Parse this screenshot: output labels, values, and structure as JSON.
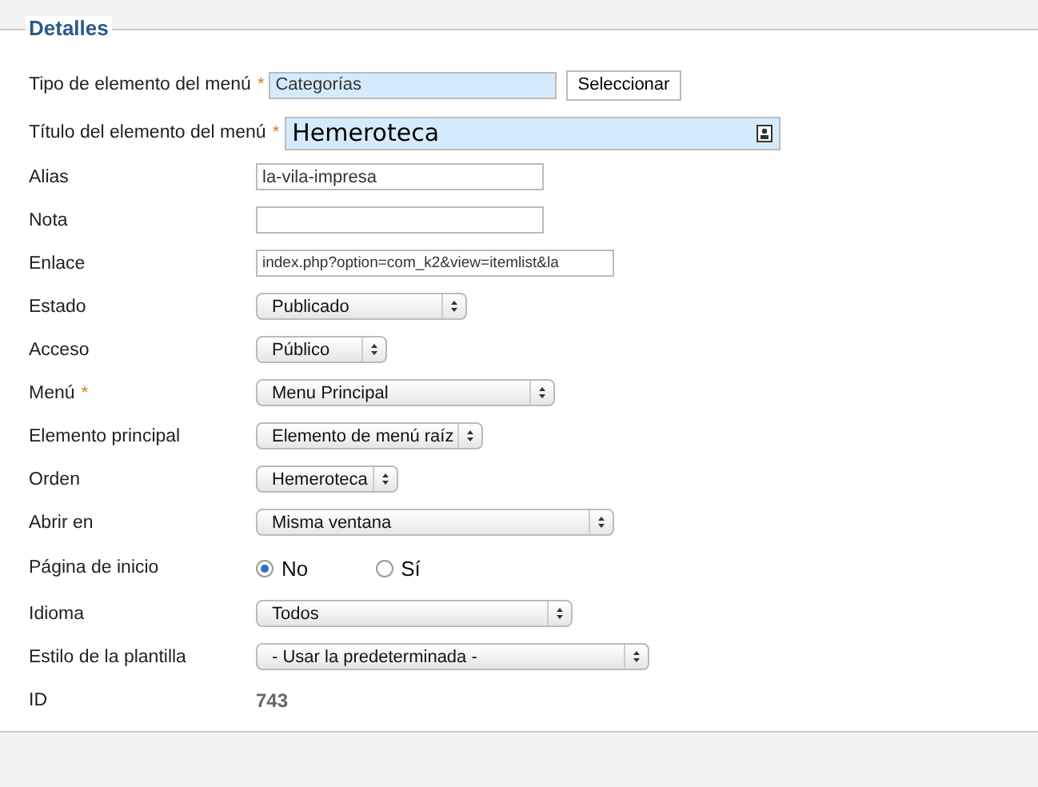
{
  "section": {
    "legend": "Detalles"
  },
  "fields": [
    {
      "kind": "picker",
      "label": "Tipo de elemento del menú",
      "required": "*",
      "value": "Categorías",
      "button": "Seleccionar"
    },
    {
      "kind": "title",
      "label": "Título del elemento del menú",
      "required": "*",
      "value": "Hemeroteca"
    },
    {
      "kind": "text",
      "label": "Alias",
      "value": "la-vila-impresa"
    },
    {
      "kind": "text",
      "label": "Nota"
    },
    {
      "kind": "link",
      "label": "Enlace",
      "value": "index.php?option=com_k2&view=itemlist&la"
    },
    {
      "kind": "select",
      "label": "Estado",
      "value": "Publicado"
    },
    {
      "kind": "select",
      "label": "Acceso",
      "value": "Público"
    },
    {
      "kind": "select",
      "label": "Menú",
      "required": "*",
      "value": "Menu Principal"
    },
    {
      "kind": "select",
      "label": "Elemento principal",
      "value": "Elemento de menú raíz"
    },
    {
      "kind": "select",
      "label": "Orden",
      "value": "Hemeroteca"
    },
    {
      "kind": "select",
      "label": "Abrir en",
      "value": "Misma ventana"
    },
    {
      "kind": "radio",
      "label": "Página de inicio",
      "options": [
        {
          "label": "No",
          "selected": true
        },
        {
          "label": "Sí",
          "selected": false
        }
      ]
    },
    {
      "kind": "select",
      "label": "Idioma",
      "value": "Todos"
    },
    {
      "kind": "select",
      "label": "Estilo de la plantilla",
      "value": "- Usar la predeterminada -"
    },
    {
      "kind": "static",
      "label": "ID",
      "value": "743"
    }
  ]
}
